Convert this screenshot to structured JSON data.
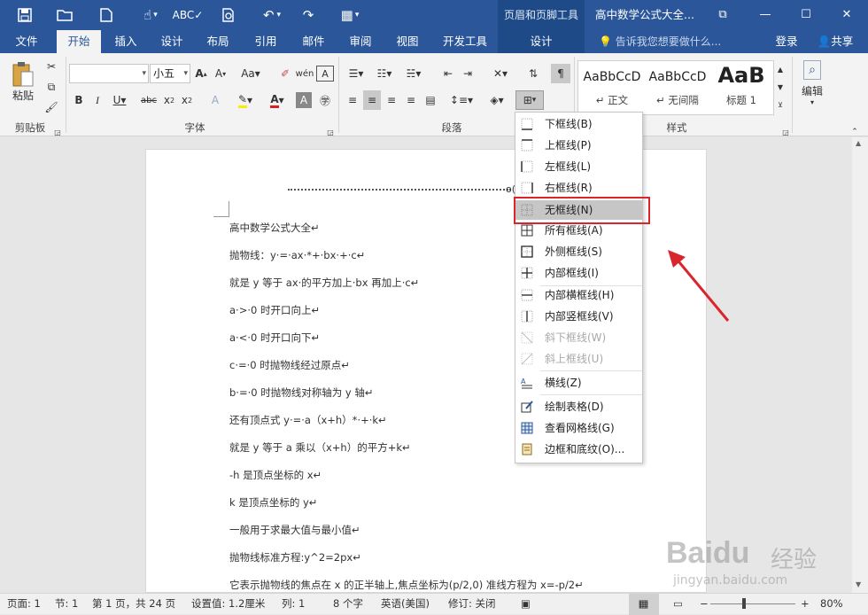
{
  "title_bar": {
    "qat_icons": [
      "save-icon",
      "open-folder-icon",
      "new-document-icon",
      "touch-mode-icon",
      "spelling-icon",
      "print-preview-icon",
      "undo-icon",
      "redo-icon",
      "insert-table-icon"
    ],
    "context_group": "页眉和页脚工具",
    "document_title": "高中数学公式大全...",
    "window_buttons": [
      "ribbon-display-icon",
      "minimize-icon",
      "maximize-icon",
      "close-icon"
    ]
  },
  "tabs": [
    {
      "label": "文件",
      "active": false
    },
    {
      "label": "开始",
      "active": true
    },
    {
      "label": "插入",
      "active": false
    },
    {
      "label": "设计",
      "active": false
    },
    {
      "label": "布局",
      "active": false
    },
    {
      "label": "引用",
      "active": false
    },
    {
      "label": "邮件",
      "active": false
    },
    {
      "label": "审阅",
      "active": false
    },
    {
      "label": "视图",
      "active": false
    },
    {
      "label": "开发工具",
      "active": false
    },
    {
      "label": "设计",
      "active": false
    }
  ],
  "tell_me": "告诉我您想要做什么...",
  "login": "登录",
  "share": "共享",
  "ribbon": {
    "clipboard": {
      "label": "剪贴板",
      "paste": "粘贴"
    },
    "font": {
      "label": "字体",
      "font_name": "",
      "font_size": "小五"
    },
    "paragraph": {
      "label": "段落"
    },
    "styles": {
      "label": "样式",
      "items": [
        {
          "sample": "AaBbCcD",
          "name": "↵ 正文"
        },
        {
          "sample": "AaBbCcD",
          "name": "↵ 无间隔"
        },
        {
          "sample": "AaB",
          "name": "标题 1"
        }
      ]
    },
    "editing": {
      "label": "编辑"
    }
  },
  "border_menu": {
    "items": [
      {
        "label": "下框线(B)",
        "icon": "bottom-border-icon",
        "disabled": false,
        "highlighted": false
      },
      {
        "label": "上框线(P)",
        "icon": "top-border-icon",
        "disabled": false,
        "highlighted": false
      },
      {
        "label": "左框线(L)",
        "icon": "left-border-icon",
        "disabled": false,
        "highlighted": false
      },
      {
        "label": "右框线(R)",
        "icon": "right-border-icon",
        "disabled": false,
        "highlighted": false
      },
      {
        "label": "无框线(N)",
        "icon": "no-border-icon",
        "disabled": false,
        "highlighted": true
      },
      {
        "label": "所有框线(A)",
        "icon": "all-borders-icon",
        "disabled": false,
        "highlighted": false
      },
      {
        "label": "外侧框线(S)",
        "icon": "outside-borders-icon",
        "disabled": false,
        "highlighted": false
      },
      {
        "label": "内部框线(I)",
        "icon": "inside-borders-icon",
        "disabled": false,
        "highlighted": false
      },
      {
        "label": "内部横框线(H)",
        "icon": "inside-horizontal-border-icon",
        "disabled": false,
        "highlighted": false
      },
      {
        "label": "内部竖框线(V)",
        "icon": "inside-vertical-border-icon",
        "disabled": false,
        "highlighted": false
      },
      {
        "label": "斜下框线(W)",
        "icon": "diagonal-down-border-icon",
        "disabled": true,
        "highlighted": false
      },
      {
        "label": "斜上框线(U)",
        "icon": "diagonal-up-border-icon",
        "disabled": true,
        "highlighted": false
      },
      {
        "label": "横线(Z)",
        "icon": "horizontal-line-icon",
        "disabled": false,
        "highlighted": false
      },
      {
        "label": "绘制表格(D)",
        "icon": "draw-table-icon",
        "disabled": false,
        "highlighted": false
      },
      {
        "label": "查看网格线(G)",
        "icon": "view-gridlines-icon",
        "disabled": false,
        "highlighted": false
      },
      {
        "label": "边框和底纹(O)...",
        "icon": "borders-shading-icon",
        "disabled": false,
        "highlighted": false
      }
    ]
  },
  "document": {
    "header_mark": "o(",
    "lines": [
      "高中数学公式大全↵",
      "抛物线：y·=·ax·*+·bx·+·c↵",
      "就是 y 等于 ax·的平方加上·bx 再加上·c↵",
      "a·>·0 时开口向上↵",
      "a·<·0 时开口向下↵",
      "c·=·0 时抛物线经过原点↵",
      "b·=·0 时抛物线对称轴为 y 轴↵",
      "还有顶点式 y·=·a（x+h）*·+·k↵",
      "就是 y 等于 a 乘以（x+h）的平方+k↵",
      "-h 是顶点坐标的 x↵",
      "k 是顶点坐标的 y↵",
      "一般用于求最大值与最小值↵",
      "抛物线标准方程:y^2=2px↵",
      "它表示抛物线的焦点在 x 的正半轴上,焦点坐标为(p/2,0) 准线方程为 x=-p/2↵"
    ]
  },
  "status_bar": {
    "page": "页面: 1",
    "section": "节: 1",
    "page_of": "第 1 页，共 24 页",
    "position": "设置值: 1.2厘米",
    "column": "列: 1",
    "word_count": "8 个字",
    "language": "英语(美国)",
    "track_changes": "修订: 关闭",
    "zoom": "80%"
  },
  "watermark": {
    "brand": "Baidu",
    "brand_cn": "经验",
    "url": "jingyan.baidu.com"
  },
  "colors": {
    "accent": "#2b579a",
    "context_tab": "#1e4a88",
    "highlight_box": "#d9262c",
    "arrow": "#d9262c"
  }
}
